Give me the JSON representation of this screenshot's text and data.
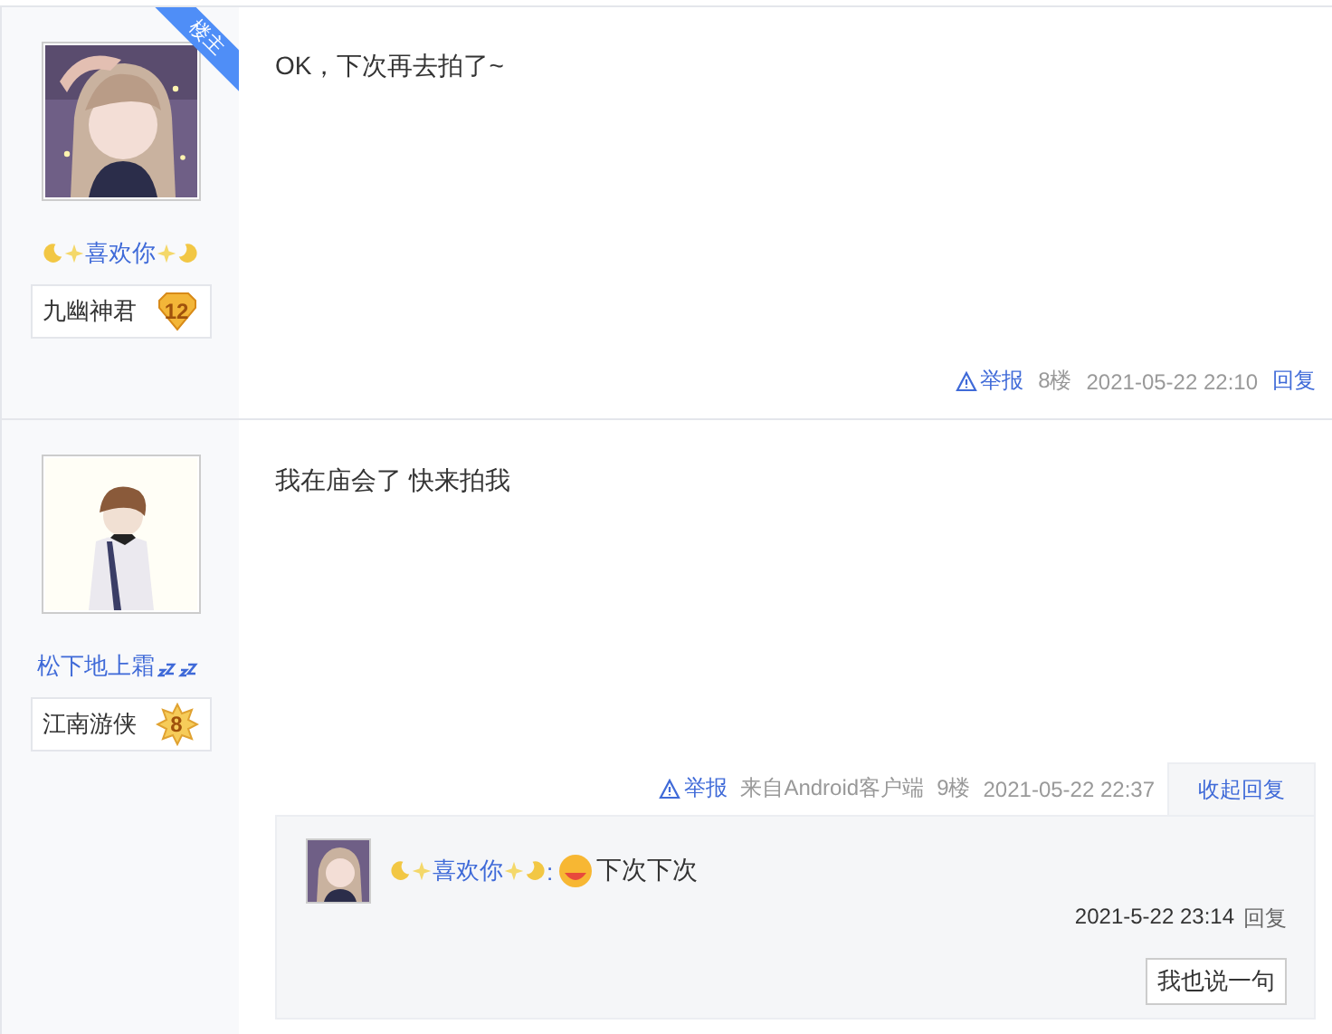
{
  "posts": [
    {
      "op": true,
      "op_label": "楼主",
      "avatar": {
        "kind": "picture"
      },
      "author": {
        "name": "喜欢你",
        "decoration": {
          "kind": "moons"
        }
      },
      "badge": {
        "title": "九幽神君",
        "level": "12",
        "kind": "shield"
      },
      "content": "OK，下次再去拍了~",
      "footer": {
        "report": "举报",
        "floor": "8楼",
        "time": "2021-05-22 22:10",
        "reply_toggle": {
          "label": "回复",
          "expanded": false
        }
      }
    },
    {
      "op": false,
      "avatar": {
        "kind": "picture"
      },
      "author": {
        "name": "松下地上霜",
        "decoration": {
          "kind": "sleep"
        }
      },
      "badge": {
        "title": "江南游侠",
        "level": "8",
        "kind": "star"
      },
      "content": "我在庙会了 快来拍我",
      "footer": {
        "report": "举报",
        "source": "来自Android客户端",
        "floor": "9楼",
        "time": "2021-05-22 22:37",
        "reply_toggle": {
          "label": "收起回复",
          "expanded": true
        }
      },
      "replies": [
        {
          "author": {
            "name": "喜欢你",
            "decoration": {
              "kind": "moons"
            }
          },
          "separator": ":",
          "emoji": true,
          "text": "下次下次",
          "time": "2021-5-22 23:14",
          "reply": "回复"
        }
      ],
      "reply_button": "我也说一句"
    }
  ]
}
